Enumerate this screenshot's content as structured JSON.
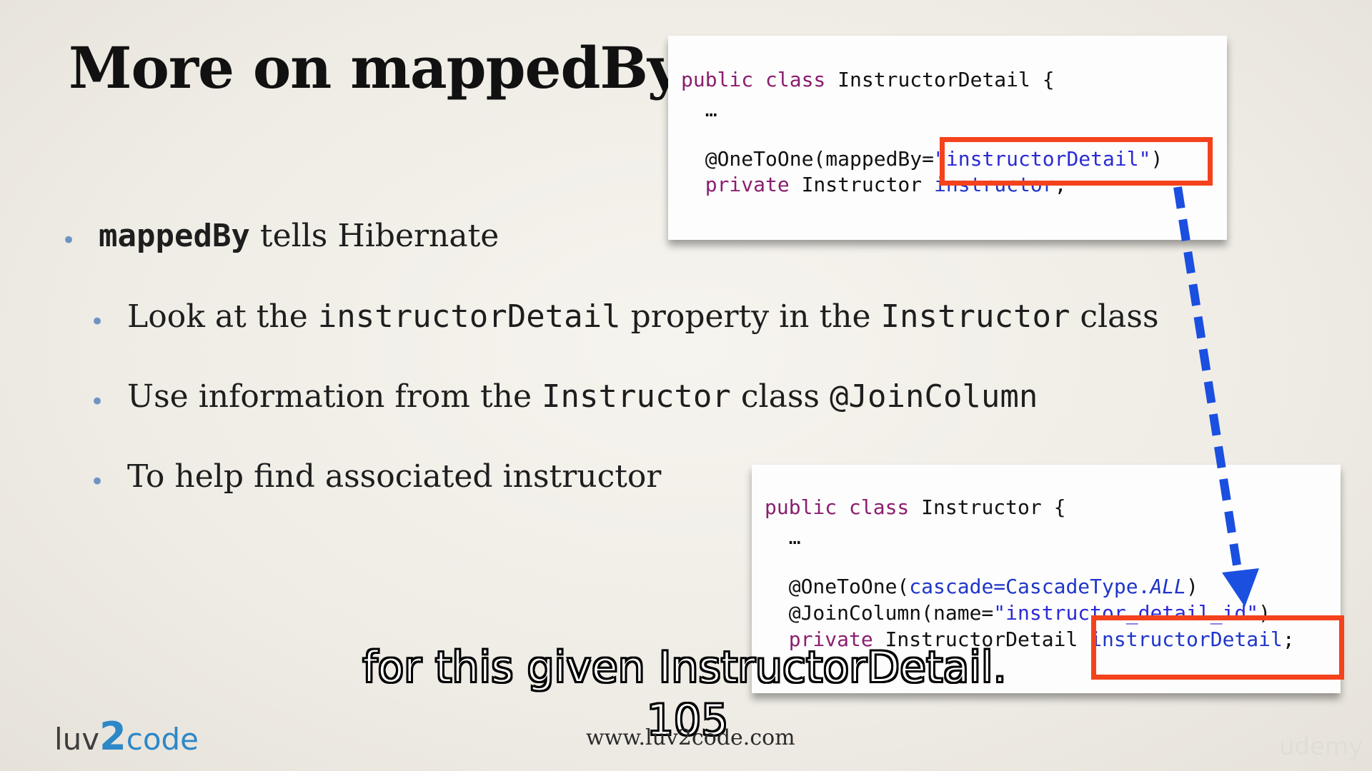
{
  "slide": {
    "title": "More on mappedBy",
    "bullets": [
      {
        "parts": [
          "mappedBy",
          " tells Hibernate"
        ]
      },
      {
        "parts": [
          "Look at the ",
          "instructorDetail",
          " property in the ",
          "Instructor",
          " class"
        ]
      },
      {
        "parts": [
          "Use information from the ",
          "Instructor",
          " class ",
          "@JoinColumn"
        ]
      },
      {
        "parts": [
          "To help find associated instructor"
        ]
      }
    ]
  },
  "code_top": {
    "line1_kw": "public class",
    "line1_name": " InstructorDetail {",
    "line2": "  …",
    "line3_ann": "  @OneToOne(mappedBy=",
    "line3_str": "\"instructorDetail\"",
    "line3_end": ")",
    "line4_kw": "  private",
    "line4_type": " Instructor ",
    "line4_field": "instructor",
    "line4_end": ";"
  },
  "code_bottom": {
    "line1_kw": "public class",
    "line1_name": " Instructor {",
    "line2": "  …",
    "line3_ann": "  @OneToOne(",
    "line3_arg": "cascade=CascadeType.",
    "line3_const": "ALL",
    "line3_end": ")",
    "line4_ann": "  @JoinColumn(name=",
    "line4_str": "\"instructor_detail_id\"",
    "line4_end": ")",
    "line5_kw": "  private",
    "line5_type": " InstructorDetail ",
    "line5_field": "instructorDetail",
    "line5_end": ";"
  },
  "subtitle": {
    "line1": "for this given InstructorDetail.",
    "line2": "105"
  },
  "footer": {
    "logo_part1": "luv",
    "logo_part2": "2",
    "logo_part3": "code",
    "url": "www.luv2code.com",
    "watermark": "udemy"
  },
  "colors": {
    "keyword": "#8a1e6e",
    "string": "#2a2ad6",
    "highlight": "#f3421c",
    "arrow": "#1a4fe0",
    "bullet": "#6c95c4"
  }
}
